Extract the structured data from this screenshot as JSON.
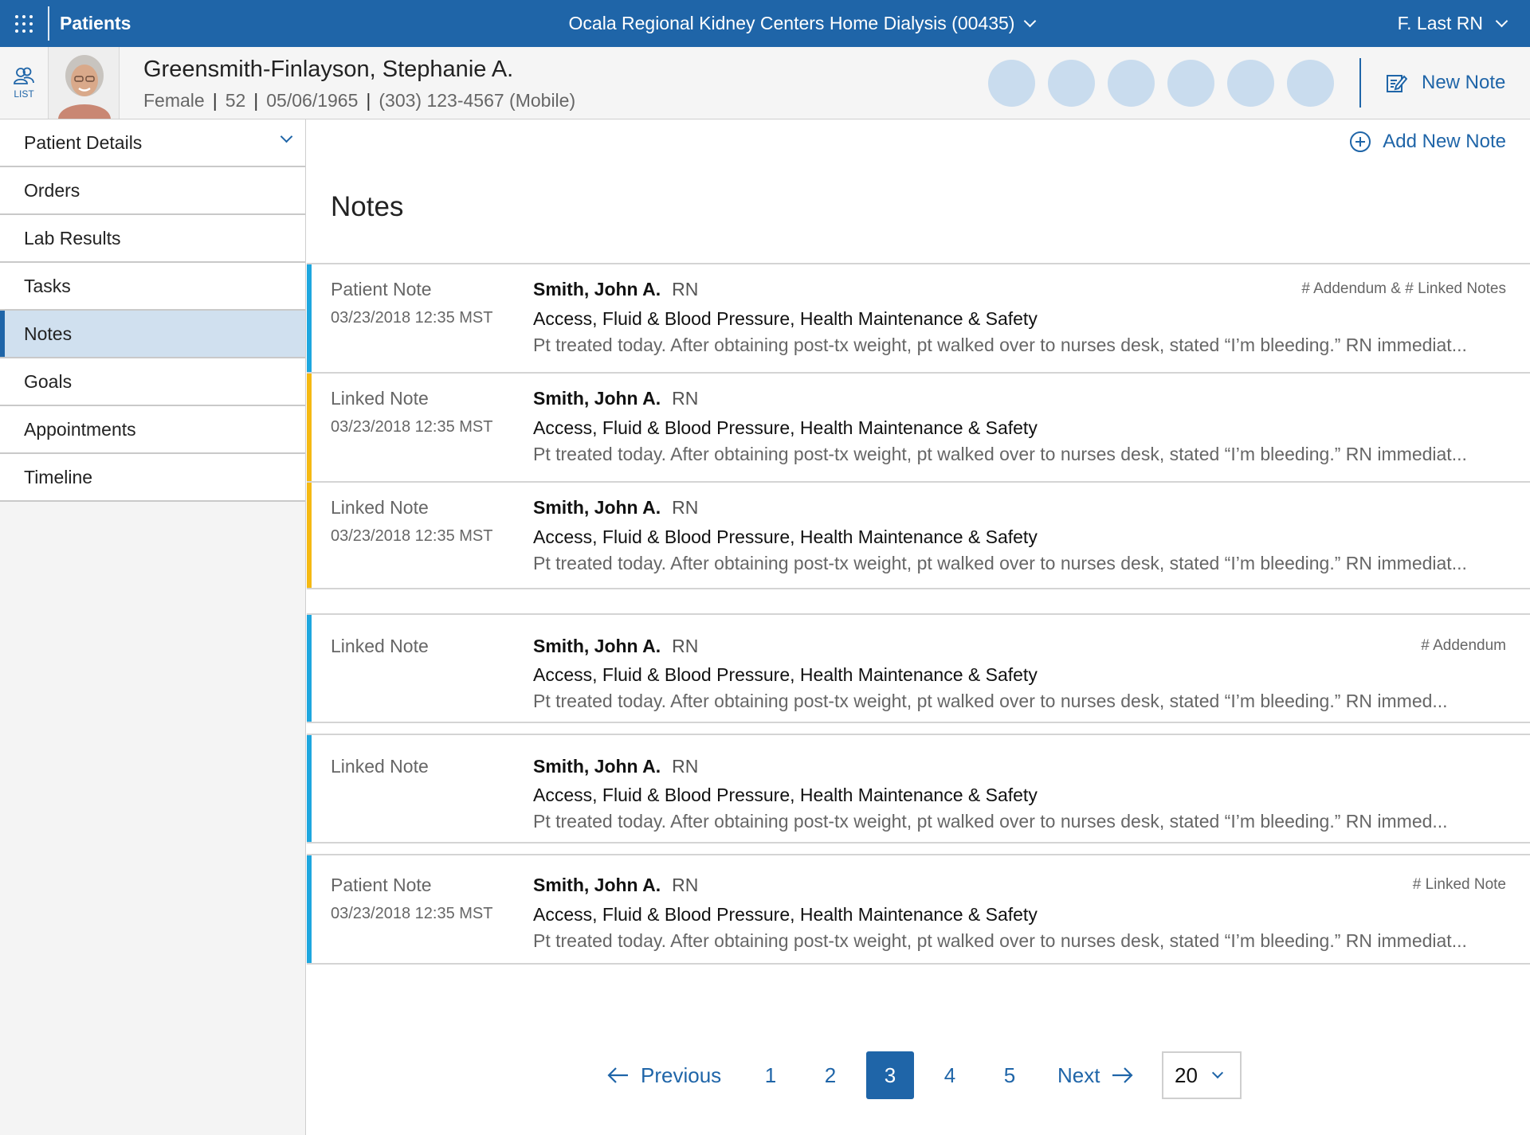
{
  "topbar": {
    "app_title": "Patients",
    "facility": "Ocala Regional Kidney Centers Home Dialysis (00435)",
    "user": "F. Last RN"
  },
  "banner": {
    "list_label": "LIST",
    "patient_name": "Greensmith-Finlayson, Stephanie A.",
    "sex": "Female",
    "age": "52",
    "dob": "05/06/1965",
    "phone": "(303) 123-4567 (Mobile)",
    "separator": "|",
    "new_note_label": "New Note"
  },
  "sidebar": {
    "items": [
      {
        "label": "Patient Details"
      },
      {
        "label": "Orders"
      },
      {
        "label": "Lab Results"
      },
      {
        "label": "Tasks"
      },
      {
        "label": "Notes"
      },
      {
        "label": "Goals"
      },
      {
        "label": "Appointments"
      },
      {
        "label": "Timeline"
      }
    ]
  },
  "main": {
    "add_note_label": "Add New Note",
    "title": "Notes",
    "notes": [
      {
        "type": "Patient Note",
        "date": "03/23/2018 12:35 MST",
        "author": "Smith, John A.",
        "role": "RN",
        "topics": "Access, Fluid & Blood Pressure, Health Maintenance & Safety",
        "preview": "Pt treated today. After obtaining post-tx weight, pt walked over to nurses desk, stated “I’m bleeding.” RN immediat...",
        "links": "#  Addendum & #  Linked Notes"
      },
      {
        "type": "Linked Note",
        "date": "03/23/2018 12:35 MST",
        "author": "Smith, John A.",
        "role": "RN",
        "topics": "Access, Fluid & Blood Pressure, Health Maintenance & Safety",
        "preview": "Pt treated today. After obtaining post-tx weight, pt walked over to nurses desk, stated “I’m bleeding.” RN immediat...",
        "links": ""
      },
      {
        "type": "Linked Note",
        "date": "03/23/2018 12:35 MST",
        "author": "Smith, John A.",
        "role": "RN",
        "topics": "Access, Fluid & Blood Pressure, Health Maintenance & Safety",
        "preview": "Pt treated today. After obtaining post-tx weight, pt walked over to nurses desk, stated “I’m bleeding.” RN immediat...",
        "links": ""
      },
      {
        "type": "Linked Note",
        "date": "",
        "author": "Smith, John A.",
        "role": "RN",
        "topics": "Access, Fluid & Blood Pressure, Health Maintenance & Safety",
        "preview": "Pt treated today. After obtaining post-tx weight, pt walked over to nurses desk, stated “I’m bleeding.” RN immed...",
        "links": "# Addendum"
      },
      {
        "type": "Linked Note",
        "date": "",
        "author": "Smith, John A.",
        "role": "RN",
        "topics": "Access, Fluid & Blood Pressure, Health Maintenance & Safety",
        "preview": "Pt treated today. After obtaining post-tx weight, pt walked over to nurses desk, stated “I’m bleeding.” RN immed...",
        "links": ""
      },
      {
        "type": "Patient Note",
        "date": "03/23/2018 12:35 MST",
        "author": "Smith, John A.",
        "role": "RN",
        "topics": "Access, Fluid & Blood Pressure, Health Maintenance & Safety",
        "preview": "Pt treated today. After obtaining post-tx weight, pt walked over to nurses desk, stated “I’m bleeding.” RN immediat...",
        "links": "# Linked Note"
      }
    ]
  },
  "pager": {
    "previous_label": "Previous",
    "next_label": "Next",
    "pages": [
      "1",
      "2",
      "3",
      "4",
      "5"
    ],
    "current_page": "3",
    "page_size": "20"
  },
  "colors": {
    "brand_blue": "#1f65a8",
    "patient_note_bar": "#1ea7df",
    "linked_note_bar": "#f5b913",
    "active_nav_bg": "#d0e0ef",
    "bubble": "#c9dcee"
  }
}
